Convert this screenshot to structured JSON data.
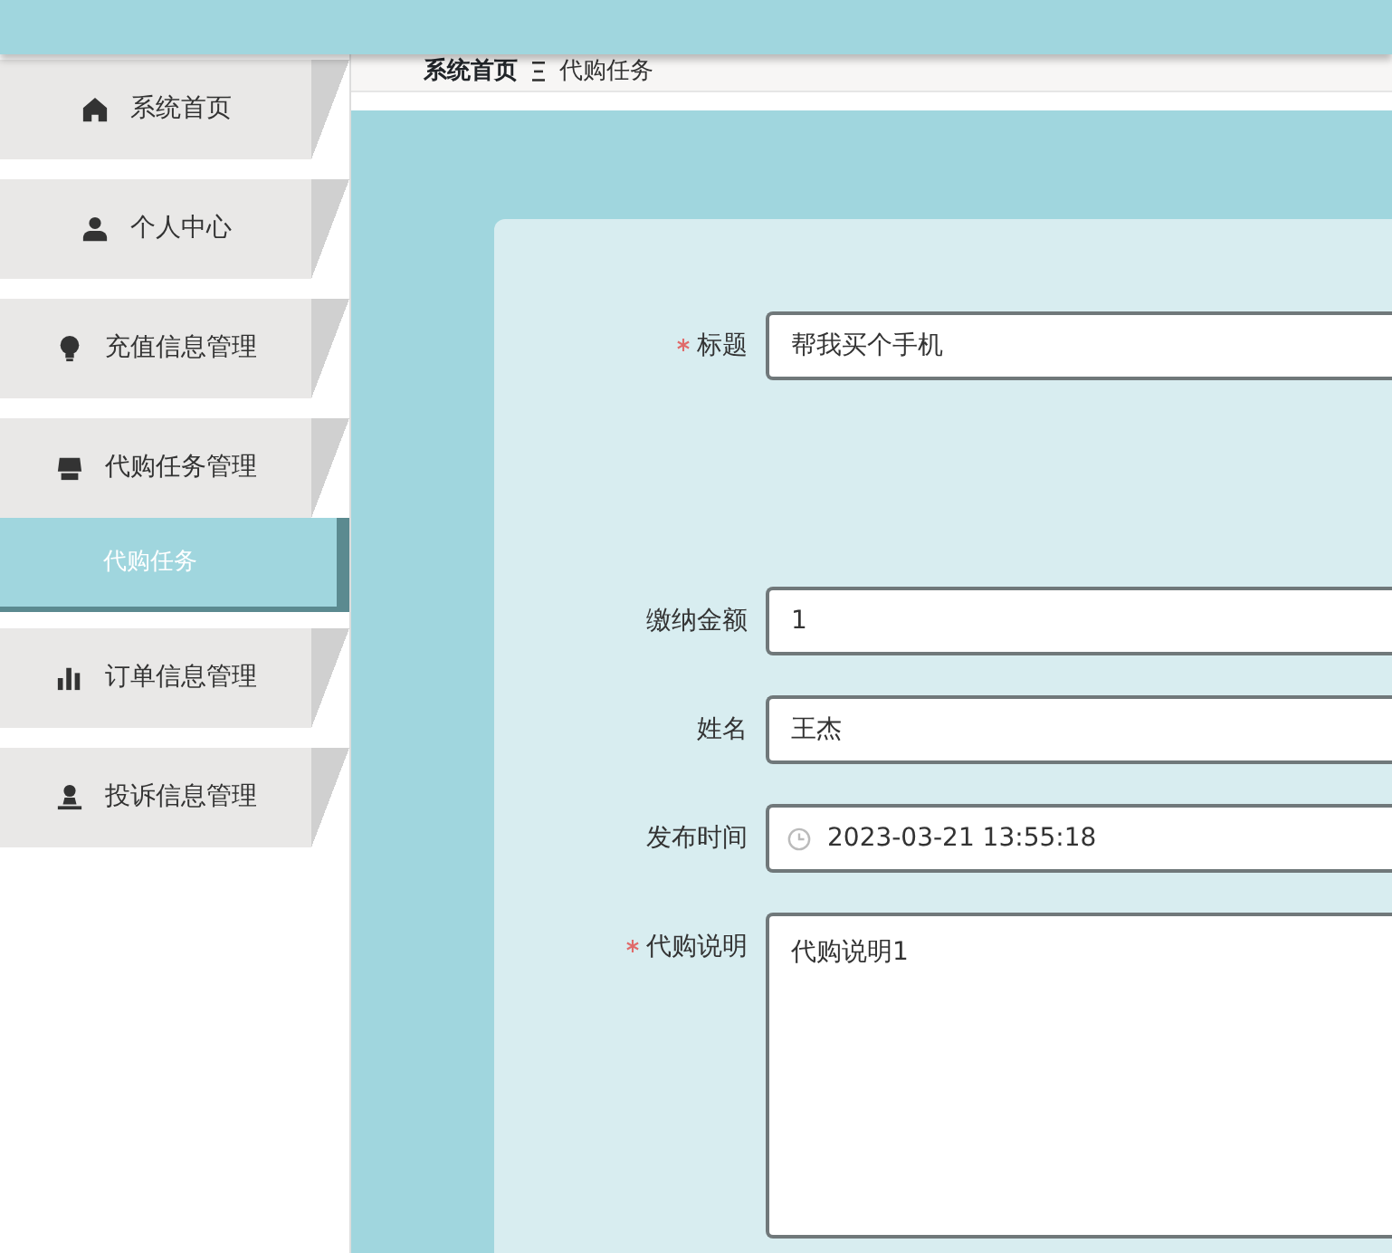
{
  "sidebar": {
    "items": [
      {
        "label": "系统首页",
        "kind": "group",
        "selected": false
      },
      {
        "label": "个人中心",
        "kind": "group",
        "selected": false
      },
      {
        "label": "充值信息管理",
        "kind": "group",
        "selected": false
      },
      {
        "label": "代购任务管理",
        "kind": "group",
        "selected": false
      },
      {
        "label": "代购任务",
        "kind": "sub",
        "selected": true
      },
      {
        "label": "订单信息管理",
        "kind": "group",
        "selected": false
      },
      {
        "label": "投诉信息管理",
        "kind": "group",
        "selected": false
      }
    ]
  },
  "breadcrumb": {
    "home": "系统首页",
    "current": "代购任务"
  },
  "form": {
    "fields": [
      {
        "label": "标题",
        "required": true,
        "kind": "text",
        "value": "帮我买个手机"
      },
      {
        "label": "缴纳金额",
        "required": false,
        "kind": "text",
        "value": "1"
      },
      {
        "label": "姓名",
        "required": false,
        "kind": "text",
        "value": "王杰"
      },
      {
        "label": "发布时间",
        "required": false,
        "kind": "datetime",
        "value": "2023-03-21 13:55:18"
      },
      {
        "label": "代购说明",
        "required": true,
        "kind": "textarea",
        "value": "代购说明1"
      }
    ]
  }
}
